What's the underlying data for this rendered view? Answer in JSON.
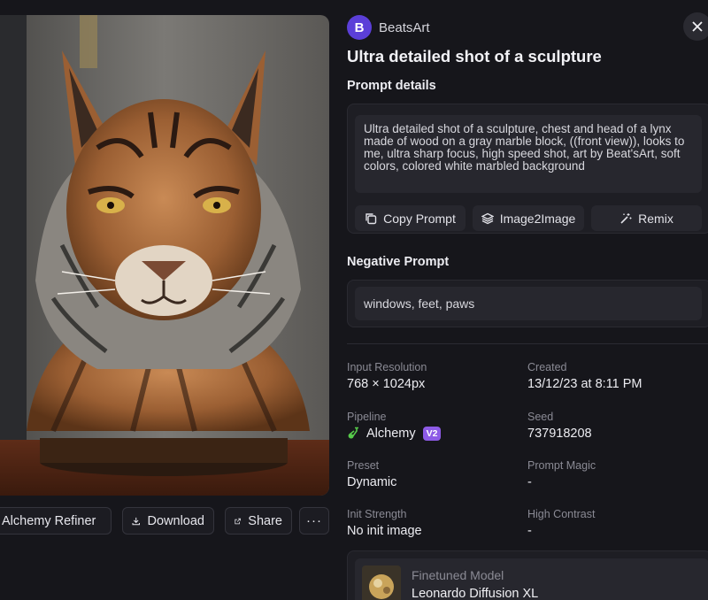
{
  "author": {
    "initial": "B",
    "name": "BeatsArt"
  },
  "title": "Ultra detailed shot of a sculpture",
  "prompt": {
    "label": "Prompt details",
    "text": "Ultra detailed shot of a sculpture, chest and head of a lynx made of wood on a gray marble block, ((front view)), looks to me, ultra sharp focus, high speed shot, art by Beat'sArt, soft colors, colored white marbled background",
    "actions": {
      "copy": "Copy Prompt",
      "image2image": "Image2Image",
      "remix": "Remix"
    }
  },
  "negative_prompt": {
    "label": "Negative Prompt",
    "text": "windows, feet, paws"
  },
  "details": {
    "input_resolution": {
      "label": "Input Resolution",
      "value": "768 × 1024px"
    },
    "created": {
      "label": "Created",
      "value": "13/12/23 at 8:11 PM"
    },
    "pipeline": {
      "label": "Pipeline",
      "value": "Alchemy",
      "badge": "V2"
    },
    "seed": {
      "label": "Seed",
      "value": "737918208"
    },
    "preset": {
      "label": "Preset",
      "value": "Dynamic"
    },
    "prompt_magic": {
      "label": "Prompt Magic",
      "value": "-"
    },
    "init_strength": {
      "label": "Init Strength",
      "value": "No init image"
    },
    "high_contrast": {
      "label": "High Contrast",
      "value": "-"
    }
  },
  "model": {
    "label": "Finetuned Model",
    "name": "Leonardo Diffusion XL"
  },
  "image_actions": {
    "refiner": "Alchemy Refiner",
    "download": "Download",
    "share": "Share",
    "more": "···"
  },
  "icons": [
    "close-icon",
    "copy-icon",
    "layers-icon",
    "magic-wand-icon",
    "download-icon",
    "share-icon",
    "more-icon",
    "alchemy-flask-icon"
  ],
  "colors": {
    "background": "#16161b",
    "card": "#1e1e24",
    "avatar": "#5b3fd8",
    "badge": "#8d5be6",
    "alchemy_icon": "#56c94a"
  }
}
